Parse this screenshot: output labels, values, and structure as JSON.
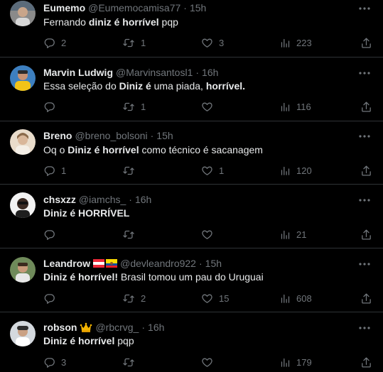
{
  "tweets": [
    {
      "name": "Eumemo",
      "handle": "@Eumemocamisa77",
      "time": "15h",
      "text": [
        {
          "t": "Fernando ",
          "b": false
        },
        {
          "t": "diniz é horrível",
          "b": true
        },
        {
          "t": " pqp",
          "b": false
        }
      ],
      "replies": "2",
      "retweets": "1",
      "likes": "3",
      "views": "223"
    },
    {
      "name": "Marvin Ludwig",
      "handle": "@Marvinsantosl1",
      "time": "16h",
      "text": [
        {
          "t": "Essa seleção do ",
          "b": false
        },
        {
          "t": "Diniz é",
          "b": true
        },
        {
          "t": " uma piada, ",
          "b": false
        },
        {
          "t": "horrível.",
          "b": true
        }
      ],
      "replies": "",
      "retweets": "1",
      "likes": "",
      "views": "116"
    },
    {
      "name": "Breno",
      "handle": "@breno_bolsoni",
      "time": "15h",
      "text": [
        {
          "t": "Oq o ",
          "b": false
        },
        {
          "t": "Diniz é horrível",
          "b": true
        },
        {
          "t": " como técnico é sacanagem",
          "b": false
        }
      ],
      "replies": "1",
      "retweets": "",
      "likes": "1",
      "views": "120"
    },
    {
      "name": "chsxzz",
      "handle": "@iamchs_",
      "time": "16h",
      "text": [
        {
          "t": "Diniz é HORRÍVEL",
          "b": true
        }
      ],
      "replies": "",
      "retweets": "",
      "likes": "",
      "views": "21"
    },
    {
      "name": "Leandrow",
      "flags": [
        "austria-flag",
        "ecuador-flag"
      ],
      "handle": "@devleandro922",
      "time": "15h",
      "text": [
        {
          "t": "Diniz é horrível!",
          "b": true
        },
        {
          "t": " Brasil tomou um pau do Uruguai",
          "b": false
        }
      ],
      "replies": "",
      "retweets": "2",
      "likes": "15",
      "views": "608"
    },
    {
      "name": "robson",
      "flags": [
        "crown-emoji"
      ],
      "handle": "@rbcrvg_",
      "time": "16h",
      "text": [
        {
          "t": "Diniz é horrível",
          "b": true
        },
        {
          "t": " pqp",
          "b": false
        }
      ],
      "replies": "3",
      "retweets": "",
      "likes": "",
      "views": "179"
    }
  ],
  "ui": {
    "separator": "·",
    "icons": {
      "more": "more-dots-icon",
      "reply": "reply-icon",
      "retweet": "retweet-icon",
      "like": "heart-icon",
      "views": "views-chart-icon",
      "share": "share-icon"
    },
    "colors": {
      "background": "#000000",
      "text": "#e7e9ea",
      "secondary": "#71767b",
      "divider": "#2f3336"
    }
  }
}
